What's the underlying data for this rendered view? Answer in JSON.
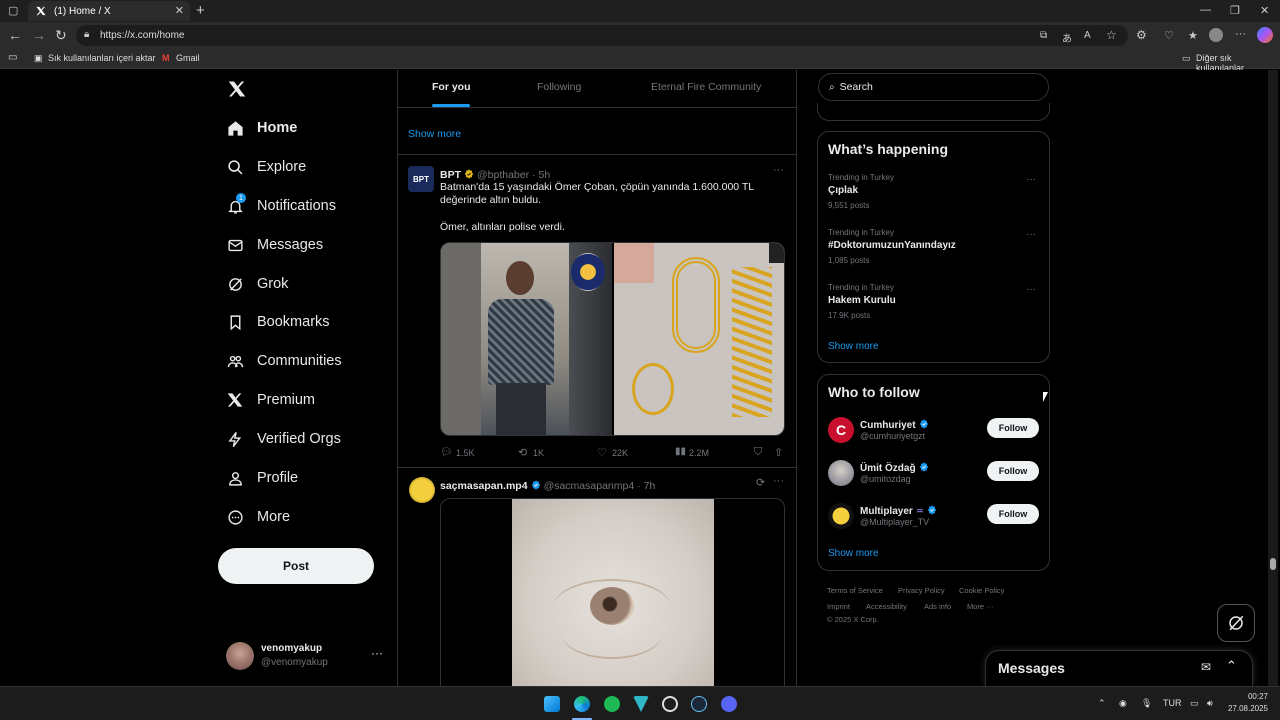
{
  "browser": {
    "tab_title": "(1) Home / X",
    "url": "https://x.com/home",
    "bookmarks": [
      "Sık kullanılanları içeri aktar",
      "Gmail"
    ],
    "other_bookmarks": "Diğer sık kullanılanlar"
  },
  "sidebar": {
    "items": [
      {
        "label": "Home",
        "icon": "home-icon",
        "active": true
      },
      {
        "label": "Explore",
        "icon": "search-icon"
      },
      {
        "label": "Notifications",
        "icon": "bell-icon",
        "badge": "1"
      },
      {
        "label": "Messages",
        "icon": "mail-icon"
      },
      {
        "label": "Grok",
        "icon": "grok-icon"
      },
      {
        "label": "Bookmarks",
        "icon": "bookmark-icon"
      },
      {
        "label": "Communities",
        "icon": "communities-icon"
      },
      {
        "label": "Premium",
        "icon": "x-icon"
      },
      {
        "label": "Verified Orgs",
        "icon": "lightning-icon"
      },
      {
        "label": "Profile",
        "icon": "person-icon"
      },
      {
        "label": "More",
        "icon": "more-circle-icon"
      }
    ],
    "post_label": "Post",
    "account": {
      "name": "venomyakup",
      "handle": "@venomyakup"
    }
  },
  "feed": {
    "tabs": [
      "For you",
      "Following",
      "Eternal Fire Community"
    ],
    "show_more": "Show more",
    "tweets": [
      {
        "name": "BPT",
        "handle": "@bpthaber",
        "time": "· 5h",
        "avatar_text": "BPT",
        "text1": "Batman'da 15 yaşındaki Ömer Çoban, çöpün yanında 1.600.000 TL değerinde altın buldu.",
        "text2": "Ömer, altınları polise verdi.",
        "replies": "1.5K",
        "reposts": "1K",
        "likes": "22K",
        "views": "2.2M"
      },
      {
        "name": "saçmasapan.mp4",
        "handle": "@sacmasapanmp4",
        "time": "· 7h"
      }
    ]
  },
  "right": {
    "search_placeholder": "Search",
    "happening": {
      "title": "What’s happening",
      "trends": [
        {
          "category": "Trending in Turkey",
          "name": "Çıplak",
          "count": "9,551 posts"
        },
        {
          "category": "Trending in Turkey",
          "name": "#DoktorumuzunYanındayız",
          "count": "1,085 posts"
        },
        {
          "category": "Trending in Turkey",
          "name": "Hakem Kurulu",
          "count": "17.9K posts"
        }
      ],
      "show_more": "Show more"
    },
    "who_to_follow": {
      "title": "Who to follow",
      "accounts": [
        {
          "name": "Cumhuriyet",
          "handle": "@cumhuriyetgzt"
        },
        {
          "name": "Ümit Özdağ",
          "handle": "@umitozdag"
        },
        {
          "name": "Multiplayer",
          "handle": "@Multiplayer_TV"
        }
      ],
      "follow_label": "Follow",
      "show_more": "Show more"
    },
    "footer": [
      "Terms of Service",
      "Privacy Policy",
      "Cookie Policy",
      "Imprint",
      "Accessibility",
      "Ads info",
      "More ···",
      "© 2025 X Corp."
    ],
    "messages_label": "Messages"
  },
  "taskbar": {
    "lang": "TUR",
    "time": "00:27",
    "date": "27.08.2025"
  },
  "colors": {
    "accent": "#1d9bf0",
    "bg": "#000000",
    "border": "#2f3336",
    "muted": "#71767b"
  }
}
